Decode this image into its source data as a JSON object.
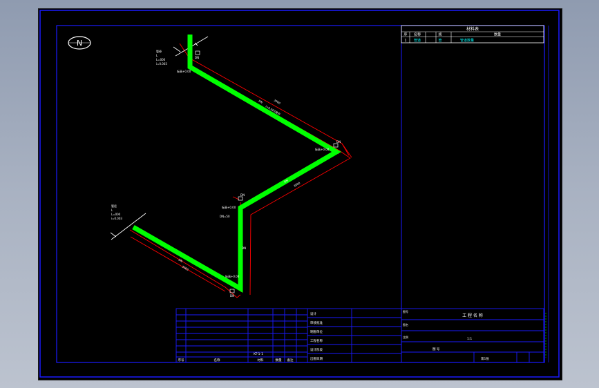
{
  "north_symbol": "N",
  "materials_table": {
    "title": "材料表",
    "headers": [
      "序",
      "名称",
      "规",
      "数量"
    ],
    "row": [
      "1",
      "管道",
      "管",
      "管道数量"
    ]
  },
  "pipe_labels": {
    "top_elev": "标高+0.00",
    "top_tag": "DN",
    "top_note_1": "管径",
    "top_note_2": "L",
    "top_note_3": "L=000",
    "top_note_4": "i=0.003",
    "seg1_len": "3000",
    "seg1_tag": "DN",
    "seg1_slope": "i=0.003坡向",
    "right_elev": "标高+0.00",
    "right_tag": "DN",
    "seg2_len": "3000",
    "seg2_tag": "DN",
    "mid_elev": "标高+0.00",
    "mid_tag": "DN",
    "mid_note": "DN=50",
    "vert_tag": "DN",
    "bot_elev": "标高+0.00",
    "bot_tag": "DN",
    "left_note_1": "管径",
    "left_note_2": "L",
    "left_note_3": "L=000",
    "left_note_4": "i=0.003",
    "seg3_tag": "DN",
    "seg3_len": "3000"
  },
  "title_block": {
    "left_footer": [
      "序号",
      "名称",
      "材料",
      "数量",
      "备注"
    ],
    "designer_rows": [
      "设计",
      "审核批准",
      "制图单位",
      "工程名称",
      "设计阶段",
      "出图日期"
    ],
    "drawing_no_label": "图号",
    "drawing_no": "KT-1-1",
    "project": "工 程 名 称",
    "right_small_1": "图名",
    "right_small_2": "比例",
    "scale": "1:1",
    "sheet_label": "图 号",
    "sheet": "第1张"
  },
  "colors": {
    "pipe": "#00ff00",
    "frame": "#1a1aff",
    "dim": "#ff0000",
    "text": "#ffffff",
    "accent": "#00ffff"
  }
}
